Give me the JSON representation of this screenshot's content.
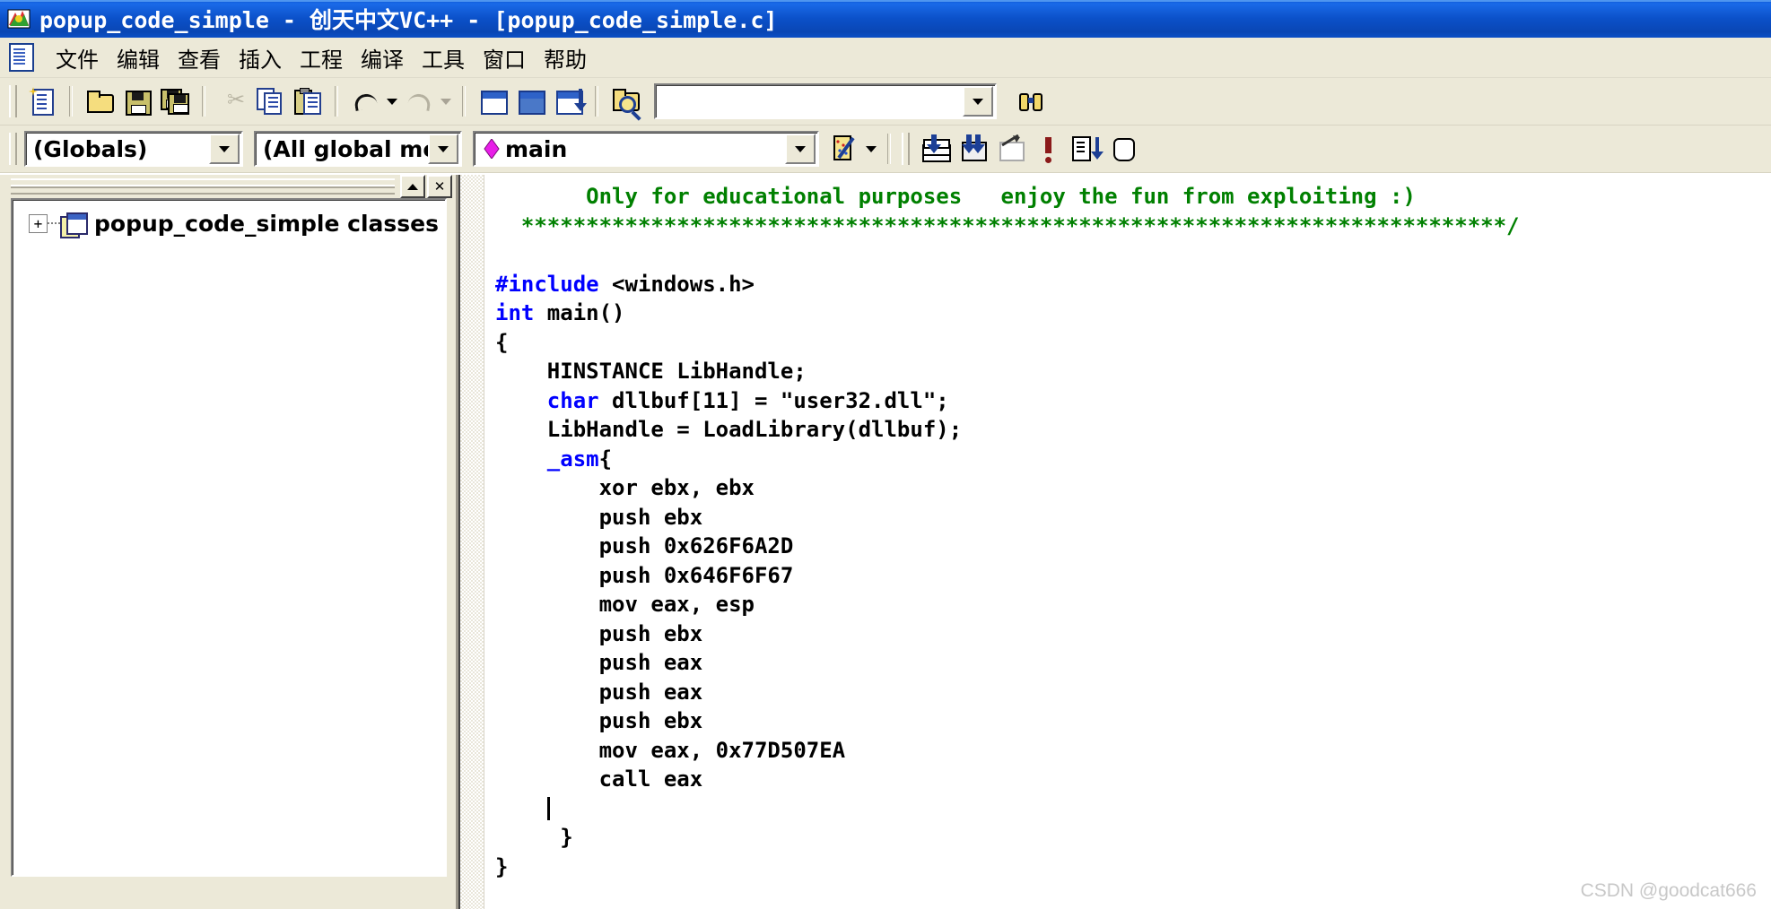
{
  "window": {
    "title": "popup_code_simple - 创天中文VC++ - [popup_code_simple.c]",
    "app_icon": "vc-app-icon"
  },
  "menubar": {
    "doc_icon": "document-icon",
    "items": [
      {
        "label": "文件",
        "name": "menu-file"
      },
      {
        "label": "编辑",
        "name": "menu-edit"
      },
      {
        "label": "查看",
        "name": "menu-view"
      },
      {
        "label": "插入",
        "name": "menu-insert"
      },
      {
        "label": "工程",
        "name": "menu-project"
      },
      {
        "label": "编译",
        "name": "menu-build"
      },
      {
        "label": "工具",
        "name": "menu-tools"
      },
      {
        "label": "窗口",
        "name": "menu-window"
      },
      {
        "label": "帮助",
        "name": "menu-help"
      }
    ]
  },
  "toolbar_standard": {
    "buttons": [
      {
        "name": "new-file-button",
        "icon": "new-document-icon"
      },
      {
        "name": "open-file-button",
        "icon": "open-folder-icon"
      },
      {
        "name": "save-button",
        "icon": "floppy-disk-icon"
      },
      {
        "name": "save-all-button",
        "icon": "save-all-icon"
      },
      {
        "name": "cut-button",
        "icon": "scissors-icon"
      },
      {
        "name": "copy-button",
        "icon": "copy-icon"
      },
      {
        "name": "paste-button",
        "icon": "paste-clipboard-icon"
      },
      {
        "name": "undo-button",
        "icon": "undo-arrow-icon"
      },
      {
        "name": "redo-button",
        "icon": "redo-arrow-icon"
      },
      {
        "name": "workspace-toggle-button",
        "icon": "workspace-window-icon"
      },
      {
        "name": "output-toggle-button",
        "icon": "output-window-icon"
      },
      {
        "name": "window-list-button",
        "icon": "window-list-icon"
      },
      {
        "name": "find-in-files-button",
        "icon": "find-in-files-icon"
      }
    ],
    "search_combo": {
      "name": "find-combo",
      "value": "",
      "placeholder": "",
      "dropdown_icon": "chevron-down-icon"
    },
    "find_next_button": {
      "name": "find-next-button",
      "icon": "binoculars-icon"
    }
  },
  "toolbar_wizardbar": {
    "class_combo": {
      "name": "class-combo",
      "value": "(Globals)",
      "dropdown_icon": "chevron-down-icon"
    },
    "filter_combo": {
      "name": "members-filter-combo",
      "value": "(All global members",
      "dropdown_icon": "chevron-down-icon"
    },
    "member_combo": {
      "name": "member-combo",
      "value": "main",
      "member_icon": "pink-diamond-icon",
      "dropdown_icon": "chevron-down-icon"
    },
    "action_button": {
      "name": "wizardbar-action-button",
      "icon": "wizard-wand-icon",
      "dropdown_icon": "chevron-down-icon"
    },
    "build_buttons": [
      {
        "name": "compile-button",
        "icon": "compile-stack-icon"
      },
      {
        "name": "build-button",
        "icon": "build-grid-icon"
      },
      {
        "name": "stop-build-button",
        "icon": "stop-build-icon"
      },
      {
        "name": "execute-button",
        "icon": "exclamation-icon"
      },
      {
        "name": "go-button",
        "icon": "go-step-icon"
      },
      {
        "name": "insert-breakpoint-button",
        "icon": "hand-icon"
      }
    ]
  },
  "workspace_pane": {
    "name": "workspace-pane",
    "caption_buttons": [
      {
        "name": "workspace-minimize-button",
        "icon": "caret-up-icon"
      },
      {
        "name": "workspace-close-button",
        "icon": "close-x-icon",
        "label": "✕"
      }
    ],
    "tree": [
      {
        "name": "tree-item-classes",
        "expander": "+",
        "icon": "classes-folder-icon",
        "label": "popup_code_simple classes"
      }
    ]
  },
  "editor": {
    "name": "code-editor",
    "filename": "popup_code_simple.c",
    "lines": [
      {
        "segments": [
          {
            "text": "       Only for educational purposes   enjoy the fun from exploiting :)",
            "style": "cmt"
          }
        ]
      },
      {
        "segments": [
          {
            "text": "  ****************************************************************************/",
            "style": "cmt"
          }
        ]
      },
      {
        "segments": [
          {
            "text": "",
            "style": "plain"
          }
        ]
      },
      {
        "segments": [
          {
            "text": "#include",
            "style": "kw"
          },
          {
            "text": " <windows.h>",
            "style": "plain"
          }
        ]
      },
      {
        "segments": [
          {
            "text": "int",
            "style": "kw"
          },
          {
            "text": " main()",
            "style": "plain"
          }
        ]
      },
      {
        "segments": [
          {
            "text": "{",
            "style": "plain"
          }
        ]
      },
      {
        "segments": [
          {
            "text": "    HINSTANCE LibHandle;",
            "style": "plain"
          }
        ]
      },
      {
        "segments": [
          {
            "text": "    ",
            "style": "plain"
          },
          {
            "text": "char",
            "style": "kw"
          },
          {
            "text": " dllbuf[11] = \"user32.dll\";",
            "style": "plain"
          }
        ]
      },
      {
        "segments": [
          {
            "text": "    LibHandle = LoadLibrary(dllbuf);",
            "style": "plain"
          }
        ]
      },
      {
        "segments": [
          {
            "text": "    ",
            "style": "plain"
          },
          {
            "text": "_asm",
            "style": "kw"
          },
          {
            "text": "{",
            "style": "plain"
          }
        ]
      },
      {
        "segments": [
          {
            "text": "        xor ebx, ebx",
            "style": "plain"
          }
        ]
      },
      {
        "segments": [
          {
            "text": "        push ebx",
            "style": "plain"
          }
        ]
      },
      {
        "segments": [
          {
            "text": "        push 0x626F6A2D",
            "style": "plain"
          }
        ]
      },
      {
        "segments": [
          {
            "text": "        push 0x646F6F67",
            "style": "plain"
          }
        ]
      },
      {
        "segments": [
          {
            "text": "        mov eax, esp",
            "style": "plain"
          }
        ]
      },
      {
        "segments": [
          {
            "text": "        push ebx",
            "style": "plain"
          }
        ]
      },
      {
        "segments": [
          {
            "text": "        push eax",
            "style": "plain"
          }
        ]
      },
      {
        "segments": [
          {
            "text": "        push eax",
            "style": "plain"
          }
        ]
      },
      {
        "segments": [
          {
            "text": "        push ebx",
            "style": "plain"
          }
        ]
      },
      {
        "segments": [
          {
            "text": "        mov eax, 0x77D507EA",
            "style": "plain"
          }
        ]
      },
      {
        "segments": [
          {
            "text": "        call eax",
            "style": "plain"
          }
        ]
      },
      {
        "segments": [
          {
            "text": "    ",
            "style": "plain"
          },
          {
            "text": "",
            "style": "caret"
          }
        ]
      },
      {
        "segments": [
          {
            "text": "     }",
            "style": "plain"
          }
        ]
      },
      {
        "segments": [
          {
            "text": "}",
            "style": "plain"
          }
        ]
      }
    ]
  },
  "watermark": {
    "text": "CSDN @goodcat666"
  },
  "colors": {
    "titlebar_blue": "#0b50c8",
    "chrome": "#ece9d8",
    "comment_green": "#008000",
    "keyword_blue": "#0000ff",
    "member_pink": "#e81ee8"
  }
}
